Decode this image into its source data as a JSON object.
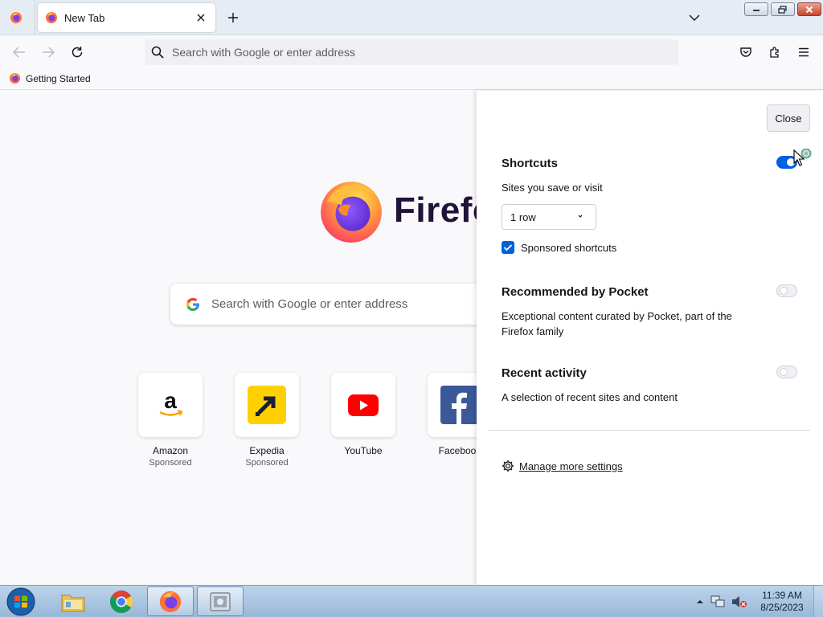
{
  "browser": {
    "tab": {
      "title": "New Tab"
    },
    "urlbar": {
      "placeholder": "Search with Google or enter address"
    },
    "bookmarks": [
      {
        "label": "Getting Started"
      }
    ]
  },
  "newtab": {
    "wordmark": "Firefox",
    "search_placeholder": "Search with Google or enter address",
    "shortcuts": [
      {
        "name": "Amazon",
        "sponsored": "Sponsored",
        "icon": "amazon-icon"
      },
      {
        "name": "Expedia",
        "sponsored": "Sponsored",
        "icon": "expedia-icon"
      },
      {
        "name": "YouTube",
        "sponsored": "",
        "icon": "youtube-icon"
      },
      {
        "name": "Facebook",
        "sponsored": "",
        "icon": "facebook-icon"
      }
    ]
  },
  "panel": {
    "close_label": "Close",
    "shortcuts": {
      "title": "Shortcuts",
      "desc": "Sites you save or visit",
      "enabled": true,
      "rows_value": "1 row",
      "sponsored_label": "Sponsored shortcuts",
      "sponsored_checked": true
    },
    "pocket": {
      "title": "Recommended by Pocket",
      "desc": "Exceptional content curated by Pocket, part of the Firefox family",
      "enabled": false
    },
    "recent": {
      "title": "Recent activity",
      "desc": "A selection of recent sites and content",
      "enabled": false
    },
    "manage_label": "Manage more settings"
  },
  "taskbar": {
    "time": "11:39 AM",
    "date": "8/25/2023"
  },
  "colors": {
    "accent": "#0060df",
    "taskbar": "#98b8d8"
  },
  "cursor_overlay": {
    "icon": "busy-cursor-icon"
  }
}
